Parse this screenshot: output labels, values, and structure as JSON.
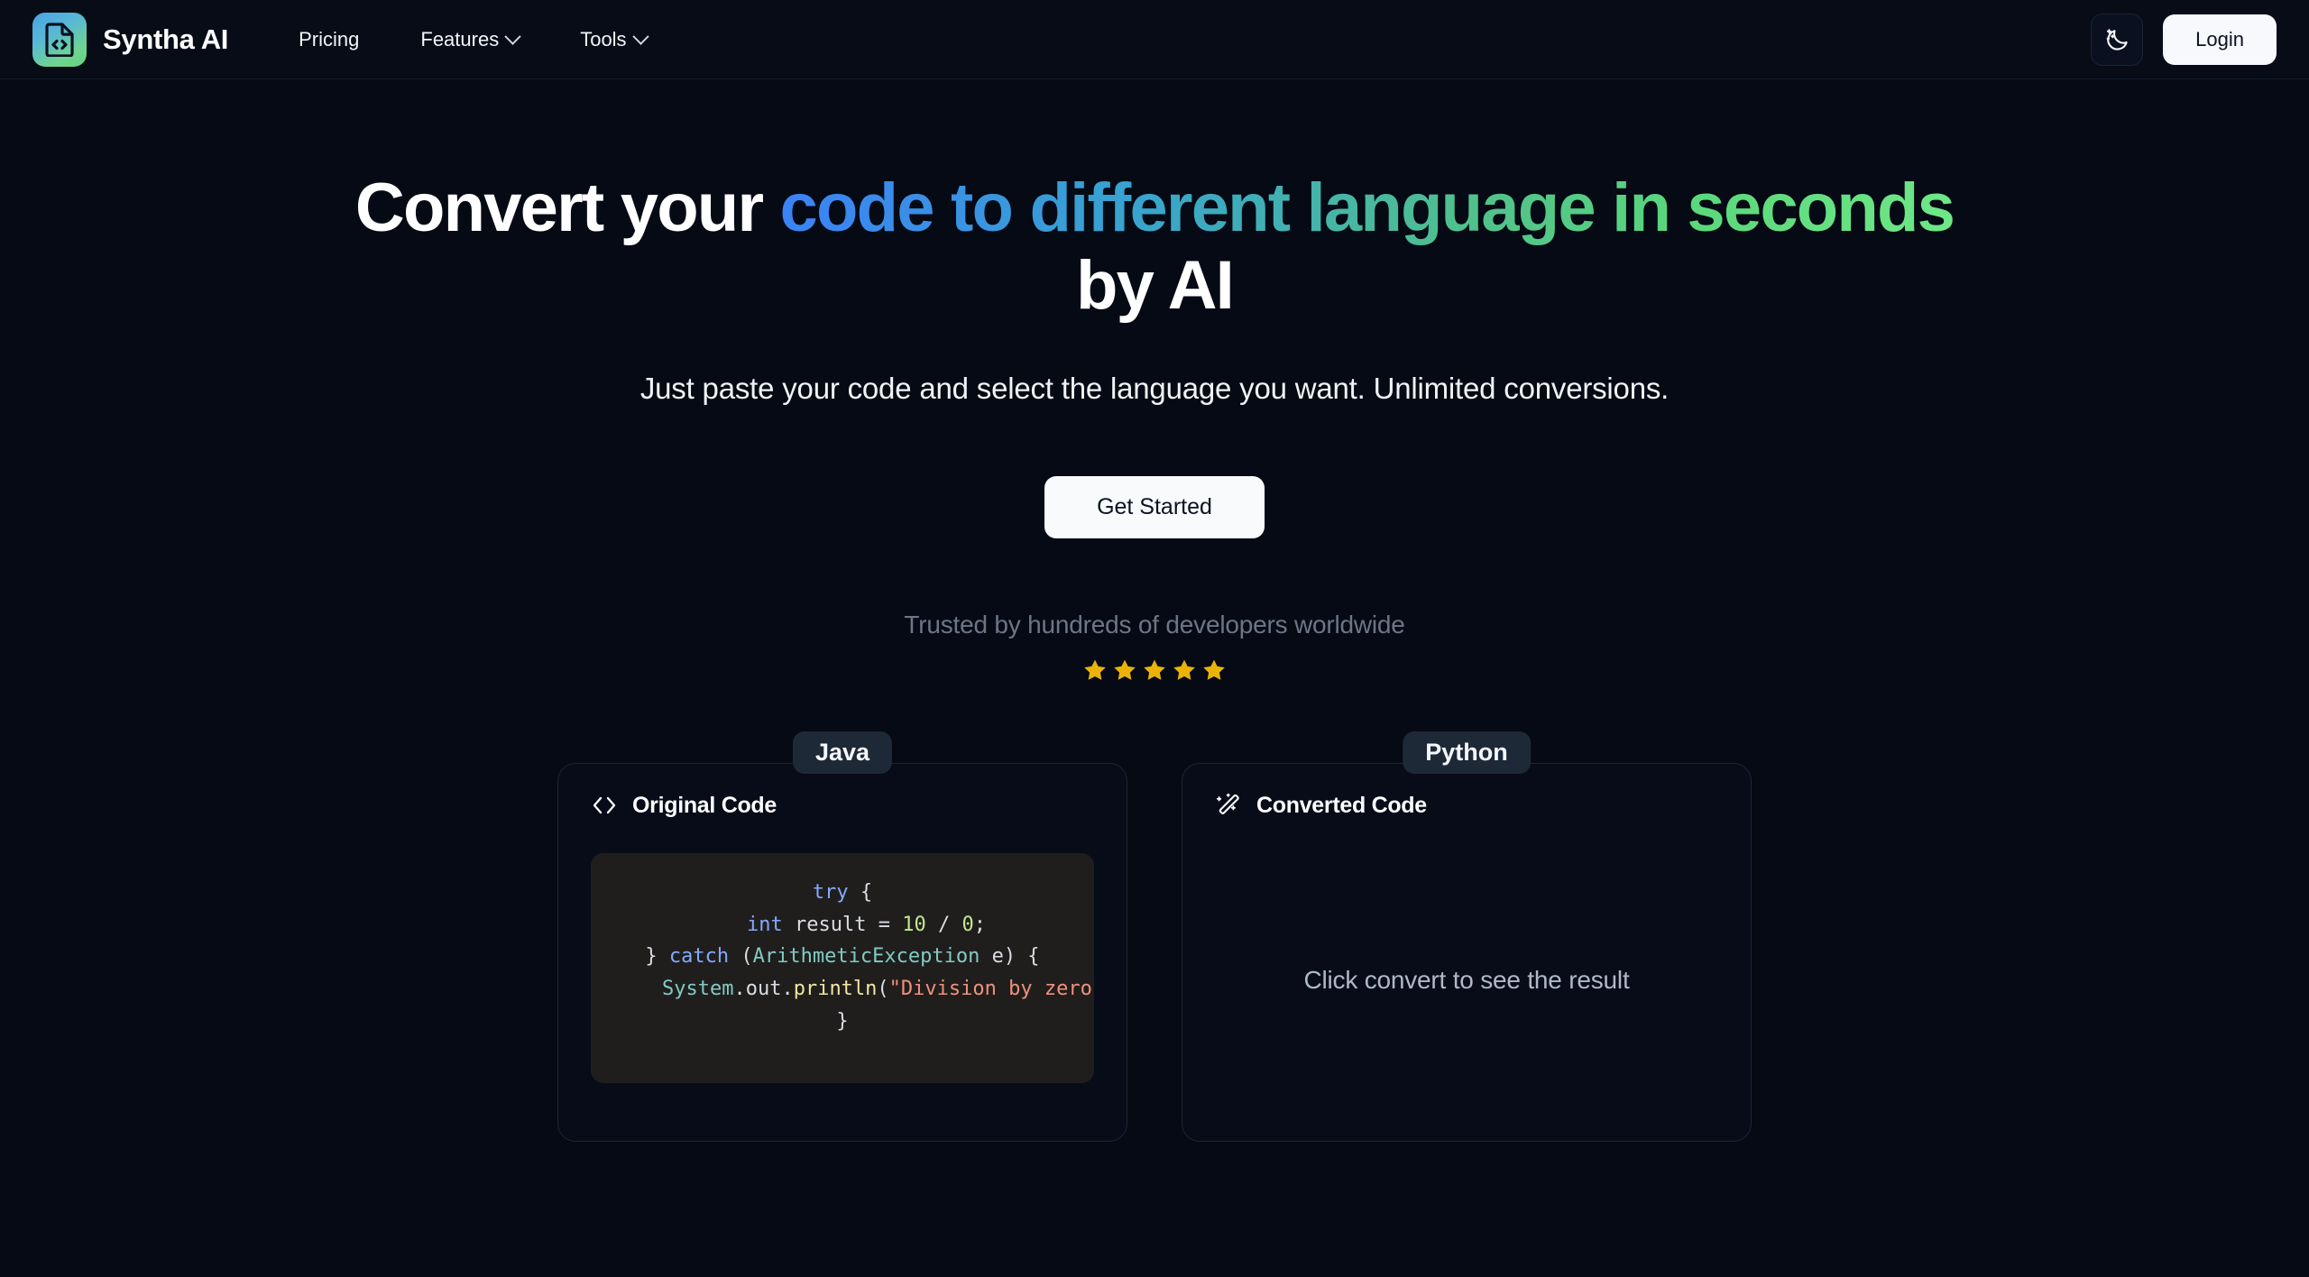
{
  "brand": {
    "name": "Syntha AI",
    "logo_icon": "code-file-icon",
    "logo_gradient_from": "#4ba3e3",
    "logo_gradient_to": "#63d47f"
  },
  "nav": {
    "items": [
      {
        "label": "Pricing",
        "has_dropdown": false
      },
      {
        "label": "Features",
        "has_dropdown": true
      },
      {
        "label": "Tools",
        "has_dropdown": true
      }
    ]
  },
  "header": {
    "theme_toggle_icon": "moon-stars-icon",
    "login_label": "Login"
  },
  "hero": {
    "headline_part1": "Convert your ",
    "headline_gradient1": "code to different language in seconds",
    "headline_part2": " by AI",
    "headline_plain_prefix": "Convert your",
    "headline_tail": "by AI",
    "subheadline": "Just paste your code and select the language you want. Unlimited conversions.",
    "cta_label": "Get Started",
    "trust_text": "Trusted by hundreds of developers worldwide",
    "rating_stars": 5,
    "star_color": "#eab308",
    "gradient_start": "#3b82f6",
    "gradient_end": "#6ee787"
  },
  "converter": {
    "source": {
      "language_badge": "Java",
      "panel_icon": "code-brackets-icon",
      "panel_title": "Original Code",
      "code_tokens": [
        [
          {
            "t": "try",
            "c": "kw"
          },
          {
            "t": " {",
            "c": "plain"
          }
        ],
        [
          {
            "t": "    ",
            "c": "plain"
          },
          {
            "t": "int",
            "c": "type"
          },
          {
            "t": " result ",
            "c": "plain"
          },
          {
            "t": "= ",
            "c": "plain"
          },
          {
            "t": "10",
            "c": "num"
          },
          {
            "t": " / ",
            "c": "plain"
          },
          {
            "t": "0",
            "c": "num"
          },
          {
            "t": ";",
            "c": "plain"
          }
        ],
        [
          {
            "t": "} ",
            "c": "plain"
          },
          {
            "t": "catch",
            "c": "kw"
          },
          {
            "t": " (",
            "c": "plain"
          },
          {
            "t": "ArithmeticException",
            "c": "cls"
          },
          {
            "t": " e) {",
            "c": "plain"
          }
        ],
        [
          {
            "t": "    ",
            "c": "plain"
          },
          {
            "t": "System",
            "c": "cls"
          },
          {
            "t": ".out.",
            "c": "plain"
          },
          {
            "t": "println",
            "c": "fn"
          },
          {
            "t": "(",
            "c": "plain"
          },
          {
            "t": "\"Division by zero!\"",
            "c": "str"
          },
          {
            "t": ");",
            "c": "plain"
          }
        ],
        [
          {
            "t": "}",
            "c": "plain"
          }
        ]
      ]
    },
    "target": {
      "language_badge": "Python",
      "panel_icon": "magic-wand-icon",
      "panel_title": "Converted Code",
      "empty_state": "Click convert to see the result"
    }
  }
}
